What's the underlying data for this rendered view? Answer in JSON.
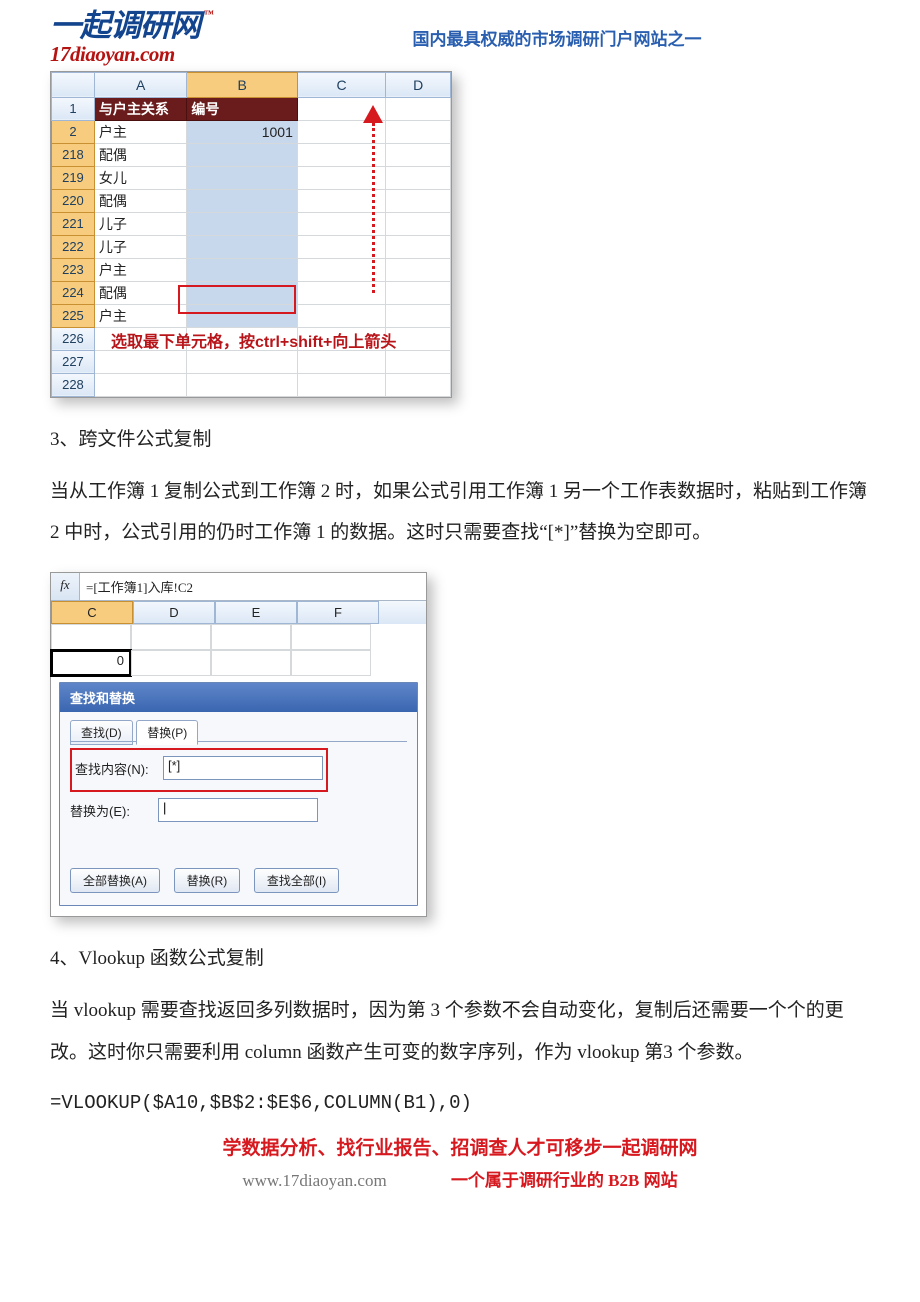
{
  "header": {
    "logo_cn": "一起调研网",
    "logo_tm": "™",
    "logo_en": "17diaoyan.com",
    "tagline": "国内最具权威的市场调研门户网站之一"
  },
  "shot1": {
    "col_headers": [
      "",
      "A",
      "B",
      "C",
      "D"
    ],
    "dark_headers": [
      "与户主关系",
      "编号"
    ],
    "rows": [
      {
        "n": "1",
        "kind": "darkhdr"
      },
      {
        "n": "2",
        "a": "户主",
        "b": "1001",
        "sel": true
      },
      {
        "n": "218",
        "a": "配偶",
        "sel": true
      },
      {
        "n": "219",
        "a": "女儿",
        "sel": true
      },
      {
        "n": "220",
        "a": "配偶",
        "sel": true
      },
      {
        "n": "221",
        "a": "儿子",
        "sel": true
      },
      {
        "n": "222",
        "a": "儿子",
        "sel": true
      },
      {
        "n": "223",
        "a": "户主",
        "sel": true
      },
      {
        "n": "224",
        "a": "配偶",
        "sel": true
      },
      {
        "n": "225",
        "a": "户主",
        "sel": true,
        "last": true
      },
      {
        "n": "226"
      },
      {
        "n": "227"
      },
      {
        "n": "228"
      }
    ],
    "annotation": "选取最下单元格，按ctrl+shift+向上箭头"
  },
  "section3": {
    "heading": "3、跨文件公式复制",
    "para": "当从工作簿 1 复制公式到工作簿 2 时，如果公式引用工作簿 1 另一个工作表数据时，粘贴到工作簿 2 中时，公式引用的仍时工作簿 1 的数据。这时只需要查找“[*]”替换为空即可。"
  },
  "shot2": {
    "fx_label": "fx",
    "formula": "=[工作簿1]入库!C2",
    "col_headers": [
      "C",
      "D",
      "E",
      "F"
    ],
    "active_value": "0",
    "win_title": "查找和替换",
    "tab_find": "查找(D)",
    "tab_replace": "替换(P)",
    "label_findwhat": "查找内容(N):",
    "val_findwhat": "[*]",
    "label_replacewith": "替换为(E):",
    "val_replacewith": "",
    "btn_replaceall": "全部替换(A)",
    "btn_replace": "替换(R)",
    "btn_findall": "查找全部(I)"
  },
  "section4": {
    "heading": "4、Vlookup 函数公式复制",
    "para": "当 vlookup 需要查找返回多列数据时，因为第 3 个参数不会自动变化，复制后还需要一个个的更改。这时你只需要利用 column 函数产生可变的数字序列，作为 vlookup 第3 个参数。",
    "formula": "=VLOOKUP($A10,$B$2:$E$6,COLUMN(B1),0)"
  },
  "footer": {
    "line1": "学数据分析、找行业报告、招调查人才可移步一起调研网",
    "line2_left": "www.17diaoyan.com",
    "line2_right": "一个属于调研行业的 B2B 网站"
  }
}
